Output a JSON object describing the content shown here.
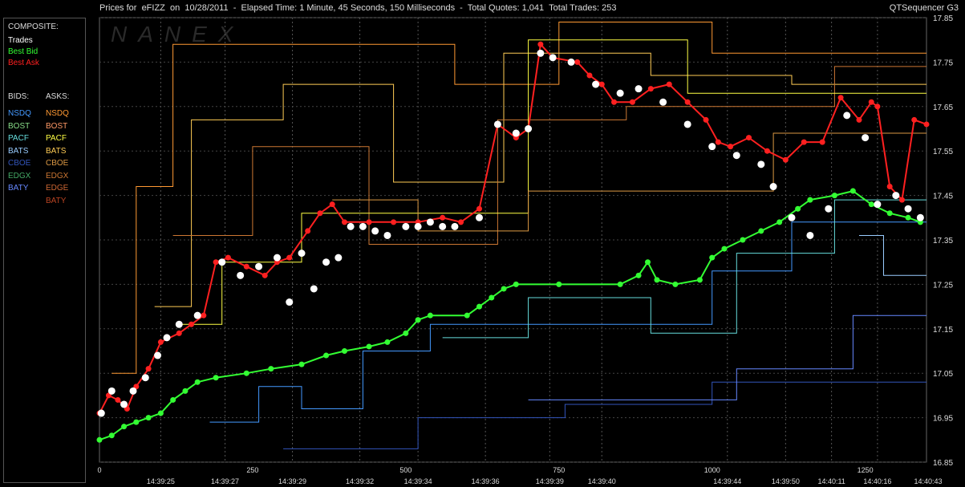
{
  "window": {
    "title": "Prices for  eFIZZ  on  10/28/2011  -  Elapsed Time: 1 Minute, 45 Seconds, 150 Milliseconds  -  Total Quotes: 1,041  Total Trades: 253",
    "app_name": "QTSequencer G3",
    "watermark": "NANEX"
  },
  "legend": {
    "composite_header": "COMPOSITE:",
    "composite": [
      {
        "label": "Trades",
        "color": "#ffffff"
      },
      {
        "label": "Best Bid",
        "color": "#33ff33"
      },
      {
        "label": "Best Ask",
        "color": "#ff2020"
      }
    ],
    "bids_header": "BIDS:",
    "asks_header": "ASKS:",
    "bids": [
      {
        "label": "NSDQ",
        "color": "#4499ff"
      },
      {
        "label": "BOST",
        "color": "#88dd88"
      },
      {
        "label": "PACF",
        "color": "#66dddd"
      },
      {
        "label": "BATS",
        "color": "#99ccff"
      },
      {
        "label": "CBOE",
        "color": "#3355bb"
      },
      {
        "label": "EDGX",
        "color": "#44aa66"
      },
      {
        "label": "BATY",
        "color": "#6688ff"
      }
    ],
    "asks": [
      {
        "label": "NSDQ",
        "color": "#ff9933"
      },
      {
        "label": "BOST",
        "color": "#ff9966"
      },
      {
        "label": "PACF",
        "color": "#ffff44"
      },
      {
        "label": "BATS",
        "color": "#ffcc55"
      },
      {
        "label": "CBOE",
        "color": "#dd9944"
      },
      {
        "label": "EDGX",
        "color": "#cc7733"
      },
      {
        "label": "EDGE",
        "color": "#cc6633"
      },
      {
        "label": "BATY",
        "color": "#bb4422"
      }
    ]
  },
  "chart_data": {
    "type": "line",
    "title": "Prices for  eFIZZ  on  10/28/2011",
    "xlim": [
      0,
      1350
    ],
    "ylim": [
      16.85,
      17.85
    ],
    "x_ticks": [
      0,
      250,
      500,
      750,
      1000,
      1250
    ],
    "y_ticks": [
      "17.85",
      "17.75",
      "17.65",
      "17.55",
      "17.45",
      "17.35",
      "17.25",
      "17.15",
      "17.05",
      "16.95",
      "16.85"
    ],
    "time_labels": [
      {
        "x": 100,
        "label": "14:39:25"
      },
      {
        "x": 205,
        "label": "14:39:27"
      },
      {
        "x": 315,
        "label": "14:39:29"
      },
      {
        "x": 425,
        "label": "14:39:32"
      },
      {
        "x": 520,
        "label": "14:39:34"
      },
      {
        "x": 630,
        "label": "14:39:36"
      },
      {
        "x": 735,
        "label": "14:39:39"
      },
      {
        "x": 820,
        "label": "14:39:40"
      },
      {
        "x": 1025,
        "label": "14:39:44"
      },
      {
        "x": 1120,
        "label": "14:39:50"
      },
      {
        "x": 1195,
        "label": "14:40:11"
      },
      {
        "x": 1270,
        "label": "14:40:16"
      },
      {
        "x": 1355,
        "label": "14:40:43"
      }
    ],
    "series": [
      {
        "name": "Best Bid",
        "color": "#33ff33",
        "points": [
          [
            0,
            16.9
          ],
          [
            20,
            16.91
          ],
          [
            40,
            16.93
          ],
          [
            60,
            16.94
          ],
          [
            80,
            16.95
          ],
          [
            100,
            16.96
          ],
          [
            120,
            16.99
          ],
          [
            140,
            17.01
          ],
          [
            160,
            17.03
          ],
          [
            190,
            17.04
          ],
          [
            240,
            17.05
          ],
          [
            280,
            17.06
          ],
          [
            330,
            17.07
          ],
          [
            370,
            17.09
          ],
          [
            400,
            17.1
          ],
          [
            440,
            17.11
          ],
          [
            470,
            17.12
          ],
          [
            500,
            17.14
          ],
          [
            520,
            17.17
          ],
          [
            540,
            17.18
          ],
          [
            600,
            17.18
          ],
          [
            620,
            17.2
          ],
          [
            640,
            17.22
          ],
          [
            660,
            17.24
          ],
          [
            680,
            17.25
          ],
          [
            750,
            17.25
          ],
          [
            850,
            17.25
          ],
          [
            880,
            17.27
          ],
          [
            895,
            17.3
          ],
          [
            910,
            17.26
          ],
          [
            940,
            17.25
          ],
          [
            980,
            17.26
          ],
          [
            1000,
            17.31
          ],
          [
            1020,
            17.33
          ],
          [
            1050,
            17.35
          ],
          [
            1080,
            17.37
          ],
          [
            1110,
            17.39
          ],
          [
            1140,
            17.42
          ],
          [
            1160,
            17.44
          ],
          [
            1200,
            17.45
          ],
          [
            1230,
            17.46
          ],
          [
            1260,
            17.43
          ],
          [
            1290,
            17.41
          ],
          [
            1320,
            17.4
          ],
          [
            1340,
            17.39
          ]
        ]
      },
      {
        "name": "Best Ask",
        "color": "#ff2020",
        "points": [
          [
            0,
            16.96
          ],
          [
            15,
            17.0
          ],
          [
            30,
            16.99
          ],
          [
            45,
            16.97
          ],
          [
            60,
            17.02
          ],
          [
            80,
            17.06
          ],
          [
            100,
            17.12
          ],
          [
            130,
            17.14
          ],
          [
            150,
            17.16
          ],
          [
            170,
            17.18
          ],
          [
            190,
            17.3
          ],
          [
            210,
            17.31
          ],
          [
            240,
            17.29
          ],
          [
            270,
            17.27
          ],
          [
            290,
            17.3
          ],
          [
            310,
            17.31
          ],
          [
            340,
            17.37
          ],
          [
            360,
            17.41
          ],
          [
            380,
            17.43
          ],
          [
            400,
            17.39
          ],
          [
            440,
            17.39
          ],
          [
            480,
            17.39
          ],
          [
            520,
            17.39
          ],
          [
            560,
            17.4
          ],
          [
            590,
            17.39
          ],
          [
            620,
            17.42
          ],
          [
            650,
            17.61
          ],
          [
            680,
            17.58
          ],
          [
            700,
            17.6
          ],
          [
            720,
            17.79
          ],
          [
            740,
            17.76
          ],
          [
            780,
            17.75
          ],
          [
            800,
            17.72
          ],
          [
            820,
            17.7
          ],
          [
            840,
            17.66
          ],
          [
            870,
            17.66
          ],
          [
            900,
            17.69
          ],
          [
            930,
            17.7
          ],
          [
            960,
            17.66
          ],
          [
            990,
            17.62
          ],
          [
            1010,
            17.57
          ],
          [
            1030,
            17.56
          ],
          [
            1060,
            17.58
          ],
          [
            1090,
            17.55
          ],
          [
            1120,
            17.53
          ],
          [
            1150,
            17.57
          ],
          [
            1180,
            17.57
          ],
          [
            1210,
            17.67
          ],
          [
            1240,
            17.62
          ],
          [
            1260,
            17.66
          ],
          [
            1270,
            17.65
          ],
          [
            1290,
            17.47
          ],
          [
            1310,
            17.44
          ],
          [
            1330,
            17.62
          ],
          [
            1350,
            17.61
          ]
        ]
      },
      {
        "name": "Trades",
        "color": "#ffffff",
        "points": [
          [
            3,
            16.96
          ],
          [
            20,
            17.01
          ],
          [
            40,
            16.98
          ],
          [
            55,
            17.01
          ],
          [
            75,
            17.04
          ],
          [
            95,
            17.09
          ],
          [
            110,
            17.13
          ],
          [
            130,
            17.16
          ],
          [
            160,
            17.18
          ],
          [
            200,
            17.3
          ],
          [
            230,
            17.27
          ],
          [
            260,
            17.29
          ],
          [
            290,
            17.31
          ],
          [
            310,
            17.21
          ],
          [
            330,
            17.32
          ],
          [
            350,
            17.24
          ],
          [
            370,
            17.3
          ],
          [
            390,
            17.31
          ],
          [
            410,
            17.38
          ],
          [
            430,
            17.38
          ],
          [
            450,
            17.37
          ],
          [
            470,
            17.36
          ],
          [
            500,
            17.38
          ],
          [
            520,
            17.38
          ],
          [
            540,
            17.39
          ],
          [
            560,
            17.38
          ],
          [
            580,
            17.38
          ],
          [
            620,
            17.4
          ],
          [
            650,
            17.61
          ],
          [
            680,
            17.59
          ],
          [
            700,
            17.6
          ],
          [
            720,
            17.77
          ],
          [
            740,
            17.76
          ],
          [
            770,
            17.75
          ],
          [
            810,
            17.7
          ],
          [
            850,
            17.68
          ],
          [
            880,
            17.69
          ],
          [
            920,
            17.66
          ],
          [
            960,
            17.61
          ],
          [
            1000,
            17.56
          ],
          [
            1040,
            17.54
          ],
          [
            1080,
            17.52
          ],
          [
            1100,
            17.47
          ],
          [
            1130,
            17.4
          ],
          [
            1160,
            17.36
          ],
          [
            1190,
            17.42
          ],
          [
            1220,
            17.63
          ],
          [
            1250,
            17.58
          ],
          [
            1270,
            17.43
          ],
          [
            1300,
            17.45
          ],
          [
            1320,
            17.42
          ],
          [
            1340,
            17.4
          ]
        ]
      }
    ],
    "sample_bid_lines": [
      {
        "color": "#4499ff",
        "points": [
          [
            180,
            16.94
          ],
          [
            260,
            16.94
          ],
          [
            260,
            17.02
          ],
          [
            330,
            17.02
          ],
          [
            330,
            16.97
          ],
          [
            430,
            16.97
          ],
          [
            430,
            17.1
          ],
          [
            540,
            17.1
          ],
          [
            540,
            17.16
          ],
          [
            1000,
            17.16
          ],
          [
            1000,
            17.28
          ],
          [
            1130,
            17.28
          ],
          [
            1130,
            17.39
          ],
          [
            1350,
            17.39
          ]
        ]
      },
      {
        "color": "#66dddd",
        "points": [
          [
            560,
            17.13
          ],
          [
            700,
            17.13
          ],
          [
            700,
            17.22
          ],
          [
            900,
            17.22
          ],
          [
            900,
            17.14
          ],
          [
            1040,
            17.14
          ],
          [
            1040,
            17.32
          ],
          [
            1200,
            17.32
          ],
          [
            1200,
            17.44
          ],
          [
            1350,
            17.44
          ]
        ]
      },
      {
        "color": "#3355bb",
        "points": [
          [
            300,
            16.88
          ],
          [
            520,
            16.88
          ],
          [
            520,
            16.95
          ],
          [
            760,
            16.95
          ],
          [
            760,
            16.98
          ],
          [
            1000,
            16.98
          ],
          [
            1000,
            17.03
          ],
          [
            1350,
            17.03
          ]
        ]
      },
      {
        "color": "#6688ff",
        "points": [
          [
            700,
            16.99
          ],
          [
            1040,
            16.99
          ],
          [
            1040,
            17.06
          ],
          [
            1230,
            17.06
          ],
          [
            1230,
            17.18
          ],
          [
            1350,
            17.18
          ]
        ]
      },
      {
        "color": "#99ccff",
        "points": [
          [
            1240,
            17.36
          ],
          [
            1280,
            17.36
          ],
          [
            1280,
            17.27
          ],
          [
            1350,
            17.27
          ]
        ]
      }
    ],
    "sample_ask_lines": [
      {
        "color": "#ff9933",
        "points": [
          [
            20,
            17.05
          ],
          [
            60,
            17.05
          ],
          [
            60,
            17.47
          ],
          [
            120,
            17.47
          ],
          [
            120,
            17.79
          ],
          [
            580,
            17.79
          ],
          [
            580,
            17.7
          ],
          [
            750,
            17.7
          ],
          [
            750,
            17.84
          ],
          [
            1000,
            17.84
          ],
          [
            1000,
            17.77
          ],
          [
            1350,
            17.77
          ]
        ]
      },
      {
        "color": "#ffcc55",
        "points": [
          [
            90,
            17.2
          ],
          [
            150,
            17.2
          ],
          [
            150,
            17.62
          ],
          [
            300,
            17.62
          ],
          [
            300,
            17.7
          ],
          [
            480,
            17.7
          ],
          [
            480,
            17.48
          ],
          [
            660,
            17.48
          ],
          [
            660,
            17.77
          ],
          [
            900,
            17.77
          ],
          [
            900,
            17.72
          ],
          [
            1130,
            17.72
          ],
          [
            1130,
            17.7
          ],
          [
            1350,
            17.7
          ]
        ]
      },
      {
        "color": "#cc7733",
        "points": [
          [
            120,
            17.36
          ],
          [
            250,
            17.36
          ],
          [
            250,
            17.56
          ],
          [
            440,
            17.56
          ],
          [
            440,
            17.34
          ],
          [
            650,
            17.34
          ],
          [
            650,
            17.62
          ],
          [
            860,
            17.62
          ],
          [
            860,
            17.65
          ],
          [
            1200,
            17.65
          ],
          [
            1200,
            17.74
          ],
          [
            1350,
            17.74
          ]
        ]
      },
      {
        "color": "#ffff44",
        "points": [
          [
            130,
            17.16
          ],
          [
            200,
            17.16
          ],
          [
            200,
            17.3
          ],
          [
            330,
            17.3
          ],
          [
            330,
            17.41
          ],
          [
            700,
            17.41
          ],
          [
            700,
            17.8
          ],
          [
            960,
            17.8
          ],
          [
            960,
            17.68
          ],
          [
            1350,
            17.68
          ]
        ]
      },
      {
        "color": "#dd9944",
        "points": [
          [
            380,
            17.44
          ],
          [
            520,
            17.44
          ],
          [
            520,
            17.37
          ],
          [
            700,
            17.37
          ],
          [
            700,
            17.46
          ],
          [
            1100,
            17.46
          ],
          [
            1100,
            17.59
          ],
          [
            1350,
            17.59
          ]
        ]
      }
    ],
    "xlabel": "",
    "ylabel": ""
  }
}
